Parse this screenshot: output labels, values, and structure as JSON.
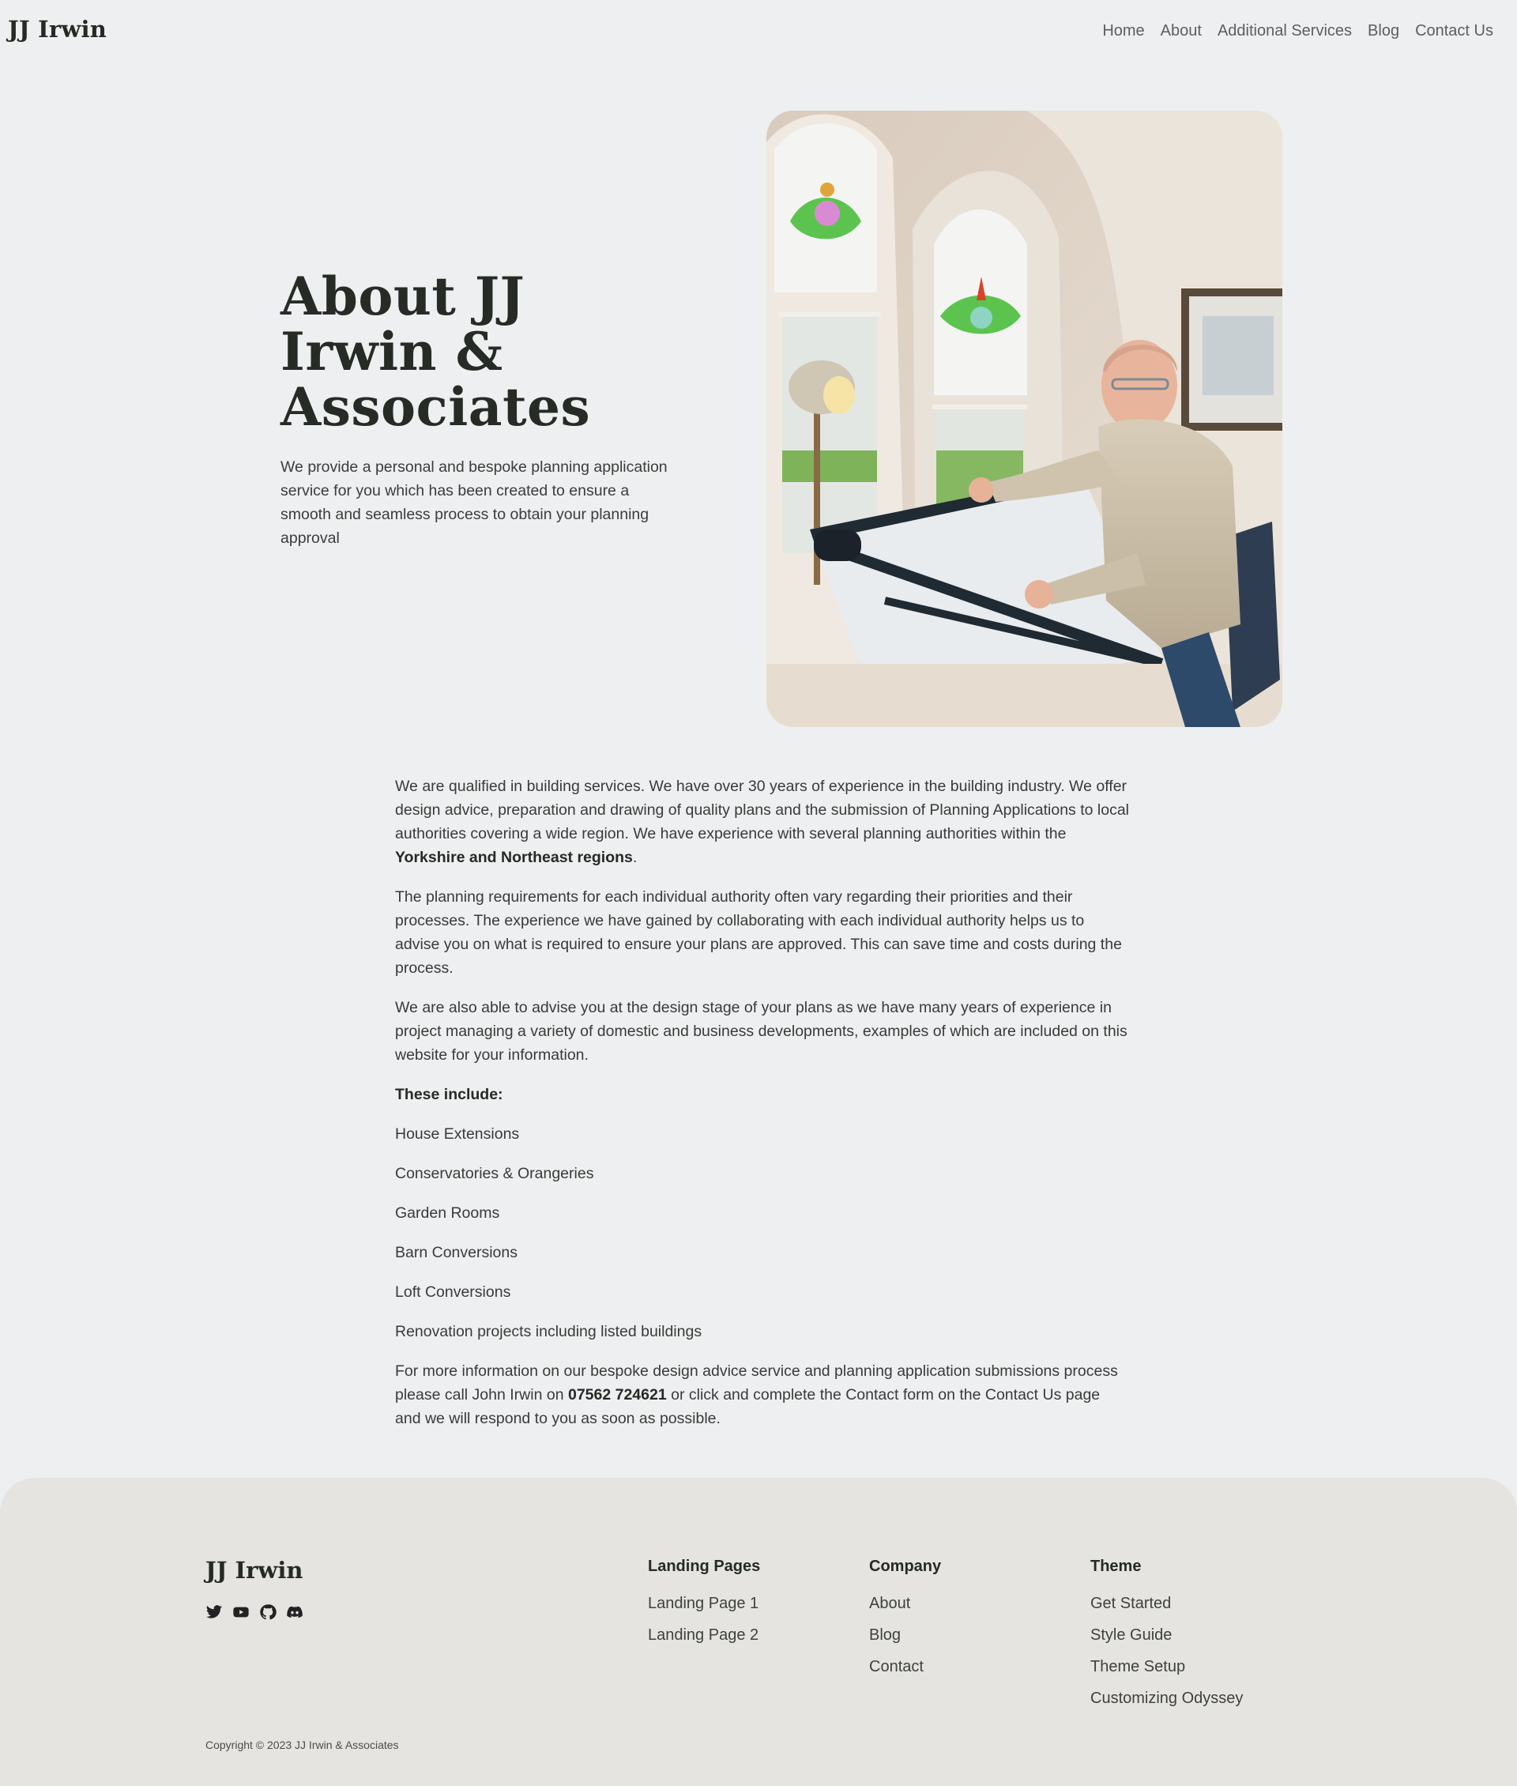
{
  "header": {
    "logo": "JJ Irwin",
    "nav": [
      "Home",
      "About",
      "Additional Services",
      "Blog",
      "Contact Us"
    ]
  },
  "hero": {
    "title": "About JJ Irwin & Associates",
    "subtitle": "We provide a personal and bespoke planning application service for you which has been created to ensure a smooth and seamless process to obtain your planning approval"
  },
  "content": {
    "p1_a": "We are qualified in building services. We have over 30 years of experience in the building industry. We offer design advice, preparation and drawing of quality plans and the submission of Planning Applications to local authorities covering a wide region. We have experience with several planning authorities within the ",
    "p1_bold": "Yorkshire and Northeast regions",
    "p1_b": ".",
    "p2": "The planning requirements for each individual authority often vary regarding their priorities and their processes. The experience we have gained by collaborating with each individual authority helps us to advise you on what is required to ensure your plans are approved. This can save time and costs during the process.",
    "p3": "We are also able to advise you at the design stage of your plans as we have many years of experience in project managing a variety of domestic and business developments, examples of which are included on this website for your information.",
    "includes_heading": "These include:",
    "includes": [
      "House Extensions",
      "Conservatories & Orangeries",
      "Garden Rooms",
      "Barn Conversions",
      "Loft Conversions",
      "Renovation projects including listed buildings"
    ],
    "contact_a": "For more information on our bespoke design advice service and planning application submissions process please call John Irwin on ",
    "contact_phone": "07562 724621",
    "contact_b": " or click and complete the Contact form on the Contact Us page and we will respond to you as soon as possible."
  },
  "footer": {
    "logo": "JJ Irwin",
    "socials": [
      "twitter-icon",
      "youtube-icon",
      "github-icon",
      "discord-icon"
    ],
    "columns": [
      {
        "heading": "Landing Pages",
        "links": [
          "Landing Page 1",
          "Landing Page 2"
        ]
      },
      {
        "heading": "Company",
        "links": [
          "About",
          "Blog",
          "Contact"
        ]
      },
      {
        "heading": "Theme",
        "links": [
          "Get Started",
          "Style Guide",
          "Theme Setup",
          "Customizing Odyssey"
        ]
      }
    ],
    "copyright": "Copyright © 2023 JJ Irwin & Associates"
  }
}
